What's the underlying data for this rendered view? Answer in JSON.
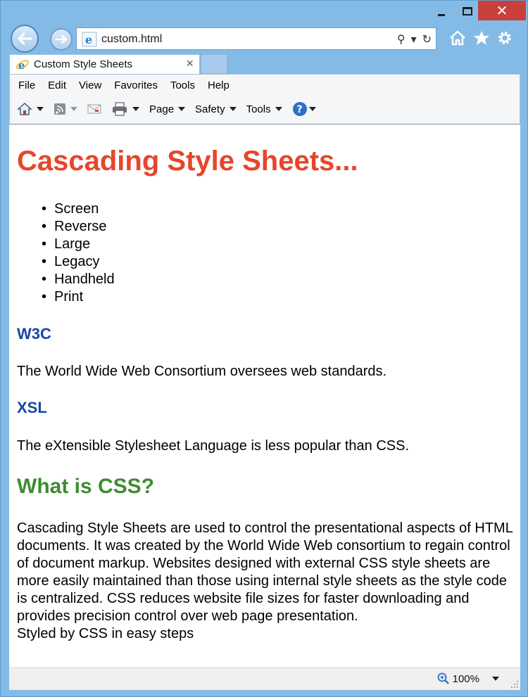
{
  "window": {
    "caption": {
      "minimize": "minimize",
      "maximize": "maximize",
      "close": "✕"
    }
  },
  "address_bar": {
    "url": "custom.html",
    "search_glyph": "⚲",
    "dropdown_glyph": "▾",
    "refresh_glyph": "↻"
  },
  "tab": {
    "title": "Custom Style Sheets",
    "close": "×"
  },
  "menu": [
    "File",
    "Edit",
    "View",
    "Favorites",
    "Tools",
    "Help"
  ],
  "command_bar": {
    "page": "Page",
    "safety": "Safety",
    "tools": "Tools"
  },
  "page": {
    "title": "Cascading Style Sheets...",
    "media_list": [
      "Screen",
      "Reverse",
      "Large",
      "Legacy",
      "Handheld",
      "Print"
    ],
    "w3c_heading": "W3C",
    "w3c_text": "The World Wide Web Consortium oversees web standards.",
    "xsl_heading": "XSL",
    "xsl_text": "The eXtensible Stylesheet Language is less popular than CSS.",
    "css_heading": "What is CSS?",
    "css_text": "Cascading Style Sheets are used to control the presentational aspects of HTML documents. It was created by the World Wide Web consortium to regain control of document markup. Websites designed with external CSS style sheets are more easily maintained than those using internal style sheets as the style code is centralized. CSS reduces website file sizes for faster downloading and provides precision control over web page presentation.",
    "footer_text": "Styled by CSS in easy steps"
  },
  "status_bar": {
    "zoom": "100%"
  },
  "colors": {
    "title": "#e8452b",
    "heading_blue": "#1648a3",
    "heading_green": "#3d8d30",
    "chrome_blue": "#83bbe6",
    "close_red": "#c7403a"
  },
  "icons": [
    "back-arrow-icon",
    "forward-arrow-icon",
    "ie-logo-icon",
    "home-icon",
    "star-icon",
    "gear-icon",
    "feeds-icon",
    "mail-icon",
    "print-icon",
    "help-icon",
    "zoom-icon"
  ]
}
